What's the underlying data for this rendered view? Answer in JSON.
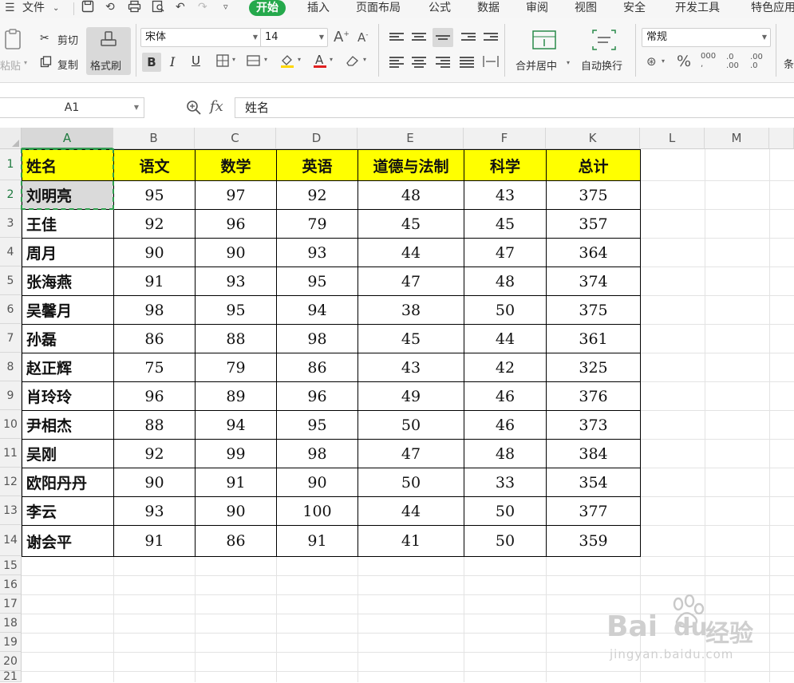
{
  "menu": {
    "file": "文件",
    "tabs": [
      "开始",
      "插入",
      "页面布局",
      "公式",
      "数据",
      "审阅",
      "视图",
      "安全",
      "开发工具",
      "特色应用"
    ],
    "active_tab": "开始"
  },
  "ribbon": {
    "paste_label": "粘贴",
    "cut_label": "剪切",
    "copy_label": "复制",
    "format_painter_label": "格式刷",
    "font_name": "宋体",
    "font_size": "14",
    "merge_label": "合并居中",
    "wrap_label": "自动换行",
    "number_format": "常规",
    "cond_label": "条"
  },
  "formula_bar": {
    "name_box": "A1",
    "fx": "fx",
    "content": "姓名"
  },
  "columns": [
    "A",
    "B",
    "C",
    "D",
    "E",
    "F",
    "K",
    "L",
    "M"
  ],
  "row_numbers": [
    "1",
    "2",
    "3",
    "4",
    "5",
    "6",
    "7",
    "8",
    "9",
    "10",
    "11",
    "12",
    "13",
    "14",
    "15",
    "16",
    "17",
    "18",
    "19",
    "20",
    "21"
  ],
  "table": {
    "headers": [
      "姓名",
      "语文",
      "数学",
      "英语",
      "道德与法制",
      "科学",
      "总计"
    ],
    "rows": [
      [
        "刘明亮",
        "95",
        "97",
        "92",
        "48",
        "43",
        "375"
      ],
      [
        "王佳",
        "92",
        "96",
        "79",
        "45",
        "45",
        "357"
      ],
      [
        "周月",
        "90",
        "90",
        "93",
        "44",
        "47",
        "364"
      ],
      [
        "张海燕",
        "91",
        "93",
        "95",
        "47",
        "48",
        "374"
      ],
      [
        "吴馨月",
        "98",
        "95",
        "94",
        "38",
        "50",
        "375"
      ],
      [
        "孙磊",
        "86",
        "88",
        "98",
        "45",
        "44",
        "361"
      ],
      [
        "赵正辉",
        "75",
        "79",
        "86",
        "43",
        "42",
        "325"
      ],
      [
        "肖玲玲",
        "96",
        "89",
        "96",
        "49",
        "46",
        "376"
      ],
      [
        "尹相杰",
        "88",
        "94",
        "95",
        "50",
        "46",
        "373"
      ],
      [
        "吴刚",
        "92",
        "99",
        "98",
        "47",
        "48",
        "384"
      ],
      [
        "欧阳丹丹",
        "90",
        "91",
        "90",
        "50",
        "33",
        "354"
      ],
      [
        "李云",
        "93",
        "90",
        "100",
        "44",
        "50",
        "377"
      ],
      [
        "谢会平",
        "91",
        "86",
        "91",
        "41",
        "50",
        "359"
      ]
    ]
  },
  "watermark": {
    "brand": "Bai",
    "brand2": "du",
    "cn": "经验",
    "url": "jingyan.baidu.com"
  },
  "colors": {
    "accent": "#25a94c",
    "header_fill": "#ffff00",
    "selection": "#2e9f4e"
  }
}
